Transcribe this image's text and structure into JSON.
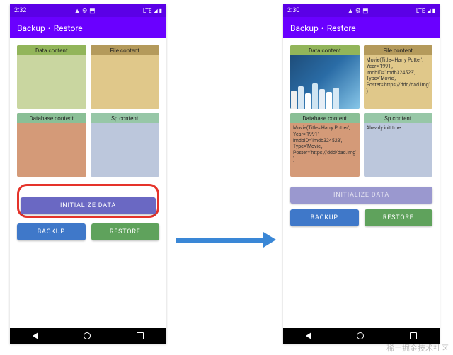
{
  "statusbar": {
    "time_left": "2:32",
    "time_right": "2:30",
    "icons": "▲ ⚙ ⬒",
    "net": "LTE ◢ ▮"
  },
  "appbar": {
    "title": "Backup・Restore"
  },
  "cards": {
    "data": {
      "label": "Data content"
    },
    "file": {
      "label": "File content"
    },
    "db": {
      "label": "Database content"
    },
    "sp": {
      "label": "Sp content"
    }
  },
  "right_content": {
    "file": "Movie(Title='Harry Potter', Year='1991', imdbID='imdb324523', Type='Movie', Poster='https://ddd/dad.img')",
    "db": "Movie(Title='Harry Potter', Year='1991', imdbID='imdb324523', Type='Movie', Poster='https://ddd/dad.img')",
    "sp": "Already init:true"
  },
  "buttons": {
    "init": "INITIALIZE DATA",
    "backup": "BACKUP",
    "restore": "RESTORE"
  },
  "watermark": "稀土掘金技术社区"
}
